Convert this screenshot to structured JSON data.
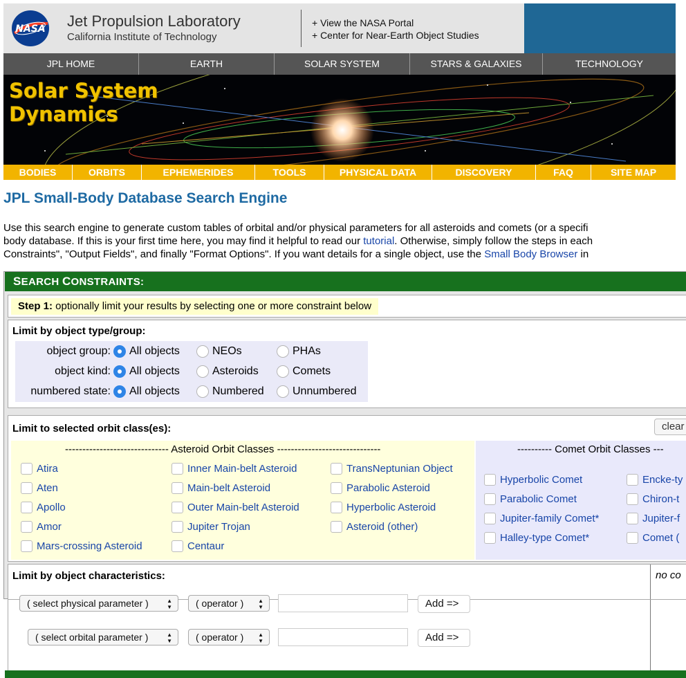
{
  "header": {
    "logo_text": "NASA",
    "lab_title": "Jet Propulsion Laboratory",
    "lab_subtitle": "California Institute of Technology",
    "links": [
      "+ View the NASA Portal",
      "+ Center for Near-Earth Object Studies"
    ]
  },
  "main_nav": [
    "JPL HOME",
    "EARTH",
    "SOLAR SYSTEM",
    "STARS & GALAXIES",
    "TECHNOLOGY"
  ],
  "banner": {
    "title_line1": "Solar System",
    "title_line2": "Dynamics"
  },
  "sub_nav": [
    "BODIES",
    "ORBITS",
    "EPHEMERIDES",
    "TOOLS",
    "PHYSICAL DATA",
    "DISCOVERY",
    "FAQ",
    "SITE MAP"
  ],
  "page_title": "JPL Small-Body Database Search Engine",
  "intro": {
    "line1": "Use this search engine to generate custom tables of orbital and/or physical parameters for all asteroids and comets (or a specifi",
    "line2_pre": "body database. If this is your first time here, you may find it helpful to read our ",
    "tutorial_link": "tutorial",
    "line2_post": ". Otherwise, simply follow the steps in each",
    "line3_pre": "Constraints\", \"Output Fields\", and finally \"Format Options\". If you want details for a single object, use the ",
    "browser_link": "Small Body Browser",
    "line3_post": " in"
  },
  "search_constraints": {
    "header_first": "S",
    "header_rest": "EARCH ",
    "header_first2": "C",
    "header_rest2": "ONSTRAINTS:",
    "step_bold": "Step 1:",
    "step_text": " optionally limit your results by selecting one or more constraint below",
    "type_label": "Limit by object type/group:",
    "type_rows": [
      {
        "label": "object group:",
        "options": [
          "All objects",
          "NEOs",
          "PHAs"
        ],
        "selected": "All objects"
      },
      {
        "label": "object kind:",
        "options": [
          "All objects",
          "Asteroids",
          "Comets"
        ],
        "selected": "All objects"
      },
      {
        "label": "numbered state:",
        "options": [
          "All objects",
          "Numbered",
          "Unnumbered"
        ],
        "selected": "All objects"
      }
    ],
    "orbit_label": "Limit to selected orbit class(es):",
    "clear_label": "clear",
    "asteroid_header": "------------------------------ Asteroid Orbit Classes ------------------------------",
    "comet_header": "---------- Comet Orbit Classes ---",
    "asteroid_classes": [
      [
        "Atira",
        "Aten",
        "Apollo",
        "Amor",
        "Mars-crossing Asteroid"
      ],
      [
        "Inner Main-belt Asteroid",
        "Main-belt Asteroid",
        "Outer Main-belt Asteroid",
        "Jupiter Trojan",
        "Centaur"
      ],
      [
        "TransNeptunian Object",
        "Parabolic Asteroid",
        "Hyperbolic Asteroid",
        "Asteroid (other)"
      ]
    ],
    "comet_classes": [
      [
        "Hyperbolic Comet",
        "Parabolic Comet",
        "Jupiter-family Comet*",
        "Halley-type Comet*"
      ],
      [
        "Encke-ty",
        "Chiron-t",
        "Jupiter-f",
        "Comet ("
      ]
    ],
    "char_label": "Limit by object characteristics:",
    "no_constraints": "no co",
    "physical_select": "( select physical parameter )",
    "orbital_select": "( select orbital parameter )",
    "operator_select": "( operator )",
    "add_label": "Add =>"
  },
  "colors": {
    "nav_gray": "#555555",
    "accent_yellow": "#f2b400",
    "section_green": "#17711e",
    "title_blue": "#1e6aa3",
    "link_blue": "#1845a8"
  }
}
